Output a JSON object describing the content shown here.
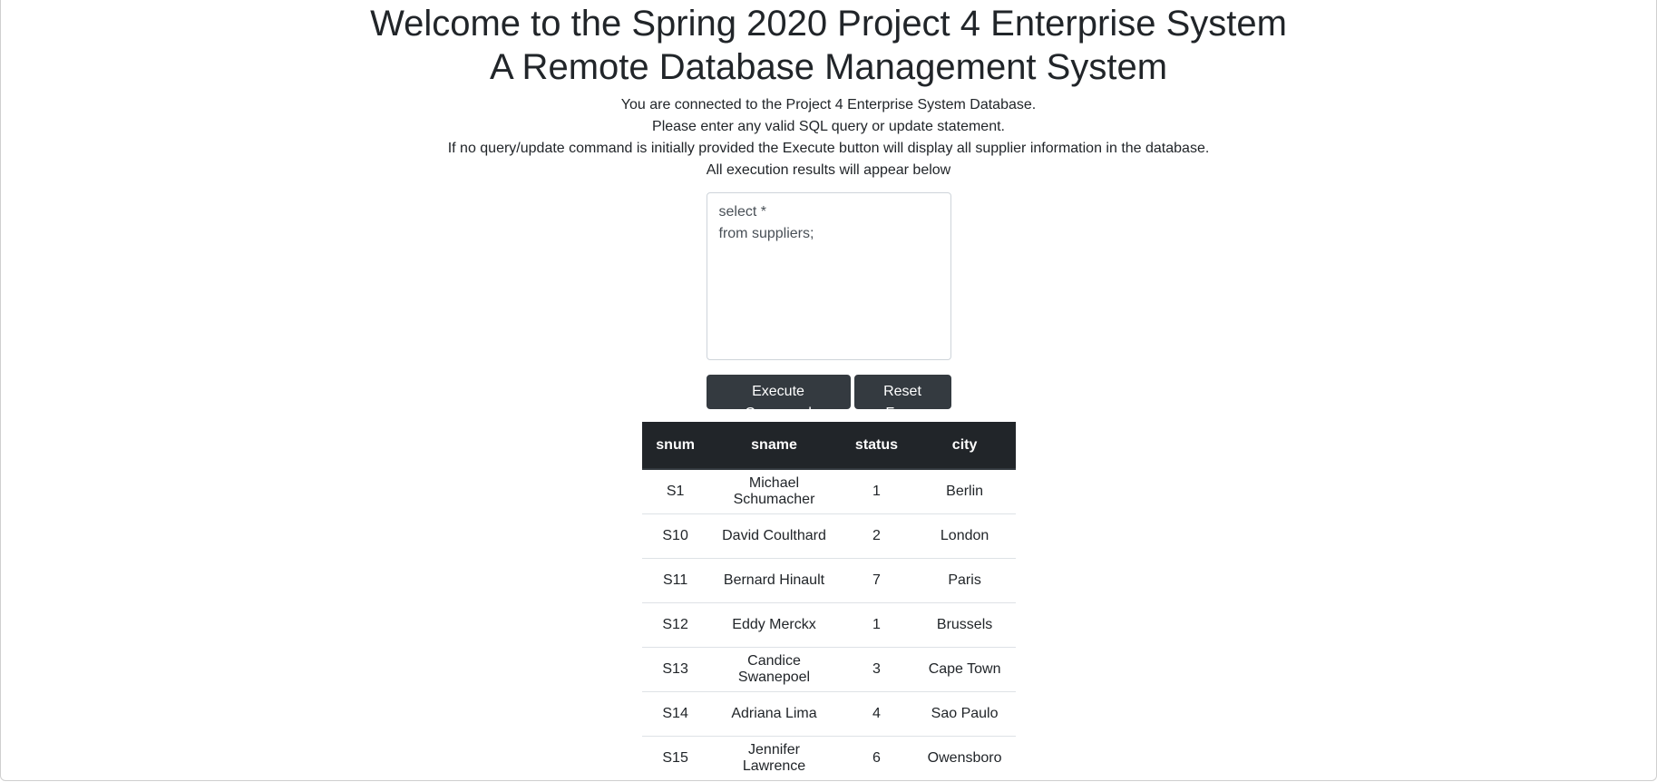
{
  "header": {
    "title_line1": "Welcome to the Spring 2020 Project 4 Enterprise System",
    "title_line2": "A Remote Database Management System"
  },
  "intro": {
    "line1": "You are connected to the Project 4 Enterprise System Database.",
    "line2": "Please enter any valid SQL query or update statement.",
    "line3": "If no query/update command is initially provided the Execute button will display all supplier information in the database.",
    "line4": "All execution results will appear below"
  },
  "query": {
    "value": "select *\nfrom suppliers;"
  },
  "buttons": {
    "execute_label": "Execute Command",
    "reset_label": "Reset Form"
  },
  "results": {
    "columns": [
      "snum",
      "sname",
      "status",
      "city"
    ],
    "rows": [
      [
        "S1",
        "Michael Schumacher",
        "1",
        "Berlin"
      ],
      [
        "S10",
        "David Coulthard",
        "2",
        "London"
      ],
      [
        "S11",
        "Bernard Hinault",
        "7",
        "Paris"
      ],
      [
        "S12",
        "Eddy Merckx",
        "1",
        "Brussels"
      ],
      [
        "S13",
        "Candice Swanepoel",
        "3",
        "Cape Town"
      ],
      [
        "S14",
        "Adriana Lima",
        "4",
        "Sao Paulo"
      ],
      [
        "S15",
        "Jennifer Lawrence",
        "6",
        "Owensboro"
      ]
    ]
  },
  "colors": {
    "button_bg": "#343a40",
    "table_header_bg": "#212529",
    "text": "#212529"
  }
}
